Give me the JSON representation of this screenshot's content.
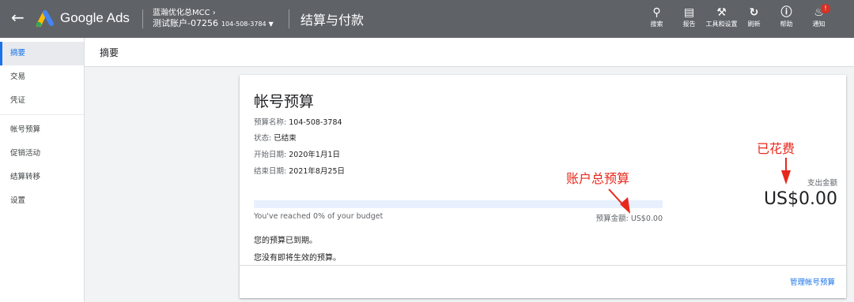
{
  "header": {
    "brand": "Google Ads",
    "account_manager": "蓝瀚优化总MCC",
    "account_name": "测试账户-07256",
    "account_id": "104-508-3784",
    "page_title": "结算与付款",
    "tools": [
      {
        "label": "搜索",
        "icon": "search-icon"
      },
      {
        "label": "报告",
        "icon": "report-icon"
      },
      {
        "label": "工具和设置",
        "icon": "wrench-icon"
      },
      {
        "label": "刷新",
        "icon": "refresh-icon"
      },
      {
        "label": "帮助",
        "icon": "help-icon"
      },
      {
        "label": "通知",
        "icon": "bell-icon",
        "badge": "!"
      }
    ]
  },
  "sidebar": {
    "items": [
      {
        "label": "摘要"
      },
      {
        "label": "交易"
      },
      {
        "label": "凭证"
      },
      {
        "label": "帐号预算"
      },
      {
        "label": "促销活动"
      },
      {
        "label": "结算转移"
      },
      {
        "label": "设置"
      }
    ]
  },
  "subheader": {
    "title": "摘要"
  },
  "budget_card": {
    "title": "帐号预算",
    "fields": [
      {
        "label": "预算名称:",
        "value": "104-508-3784"
      },
      {
        "label": "状态:",
        "value": "已结束"
      },
      {
        "label": "开始日期:",
        "value": "2020年1月1日"
      },
      {
        "label": "结束日期:",
        "value": "2021年8月25日"
      }
    ],
    "progress_fraction": 0,
    "reached_text": "You've reached 0% of your budget",
    "budget_amount_text": "预算金额: US$0.00",
    "spend_label": "支出金额",
    "spend_value": "US$0.00",
    "notes": [
      "您的预算已到期。",
      "您没有即将生效的预算。"
    ],
    "manage_link": "管理帐号预算"
  },
  "annotations": {
    "spent": "已花费",
    "total_budget": "账户总预算",
    "color": "#e8271b"
  },
  "colors": {
    "accent": "#1a73e8",
    "header_bg": "#5f6368"
  }
}
